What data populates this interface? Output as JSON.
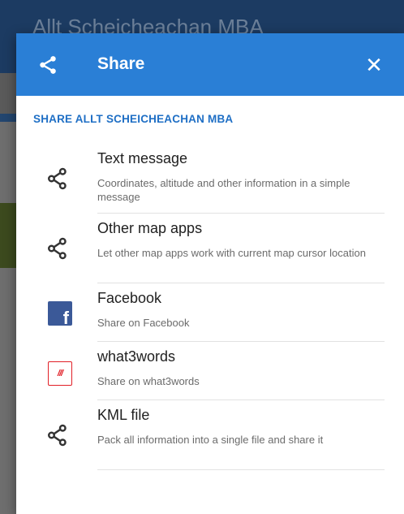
{
  "background": {
    "title": "Allt Scheicheachan MBA"
  },
  "dialog": {
    "title": "Share",
    "header_icon": "share-icon",
    "close_icon": "close-icon",
    "close_label": "✕",
    "accent_color": "#2a7fd6"
  },
  "section": {
    "title": "SHARE ALLT SCHEICHEACHAN MBA"
  },
  "items": [
    {
      "title": "Text message",
      "description": "Coordinates, altitude and other information in a simple message",
      "icon": "share-icon"
    },
    {
      "title": "Other map apps",
      "description": "Let other map apps work with current map cursor location",
      "icon": "share-icon"
    },
    {
      "title": "Facebook",
      "description": "Share on Facebook",
      "icon": "facebook-icon",
      "icon_glyph": "f"
    },
    {
      "title": "what3words",
      "description": "Share on what3words",
      "icon": "what3words-icon",
      "icon_glyph": "///"
    },
    {
      "title": "KML file",
      "description": "Pack all information into a single file and share it",
      "icon": "share-icon"
    }
  ]
}
